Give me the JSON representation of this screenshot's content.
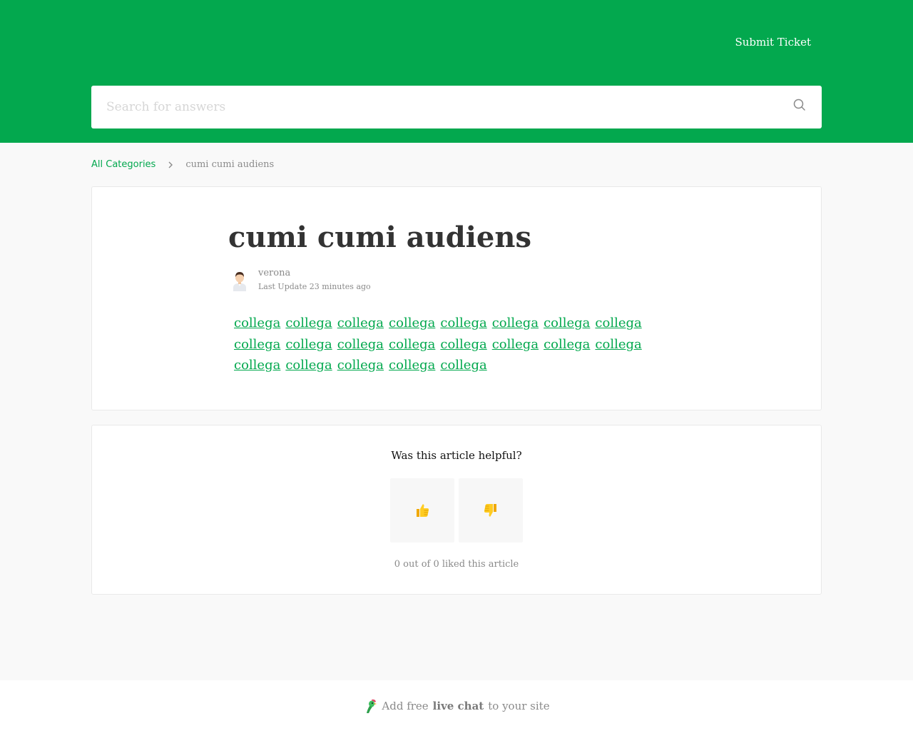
{
  "header": {
    "submit_ticket": "Submit Ticket",
    "brand_color": "#03a84e"
  },
  "search": {
    "placeholder": "Search for answers",
    "icon": "search-icon"
  },
  "breadcrumb": {
    "root": "All Categories",
    "current": "cumi cumi audiens"
  },
  "article": {
    "title": "cumi cumi audiens",
    "author": "verona",
    "last_update": "Last Update 23 minutes ago",
    "links": [
      "collega",
      "collega",
      "collega",
      "collega",
      "collega",
      "collega",
      "collega",
      "collega",
      "collega",
      "collega",
      "collega",
      "collega",
      "collega",
      "collega",
      "collega",
      "collega",
      "collega",
      "collega",
      "collega",
      "collega",
      "collega"
    ]
  },
  "feedback": {
    "question": "Was this article helpful?",
    "thumbs_up_icon": "thumbs-up-icon",
    "thumbs_down_icon": "thumbs-down-icon",
    "count_text": "0 out of 0 liked this article"
  },
  "footer": {
    "prefix": "Add free",
    "bold": "live chat",
    "suffix": "to your site"
  }
}
